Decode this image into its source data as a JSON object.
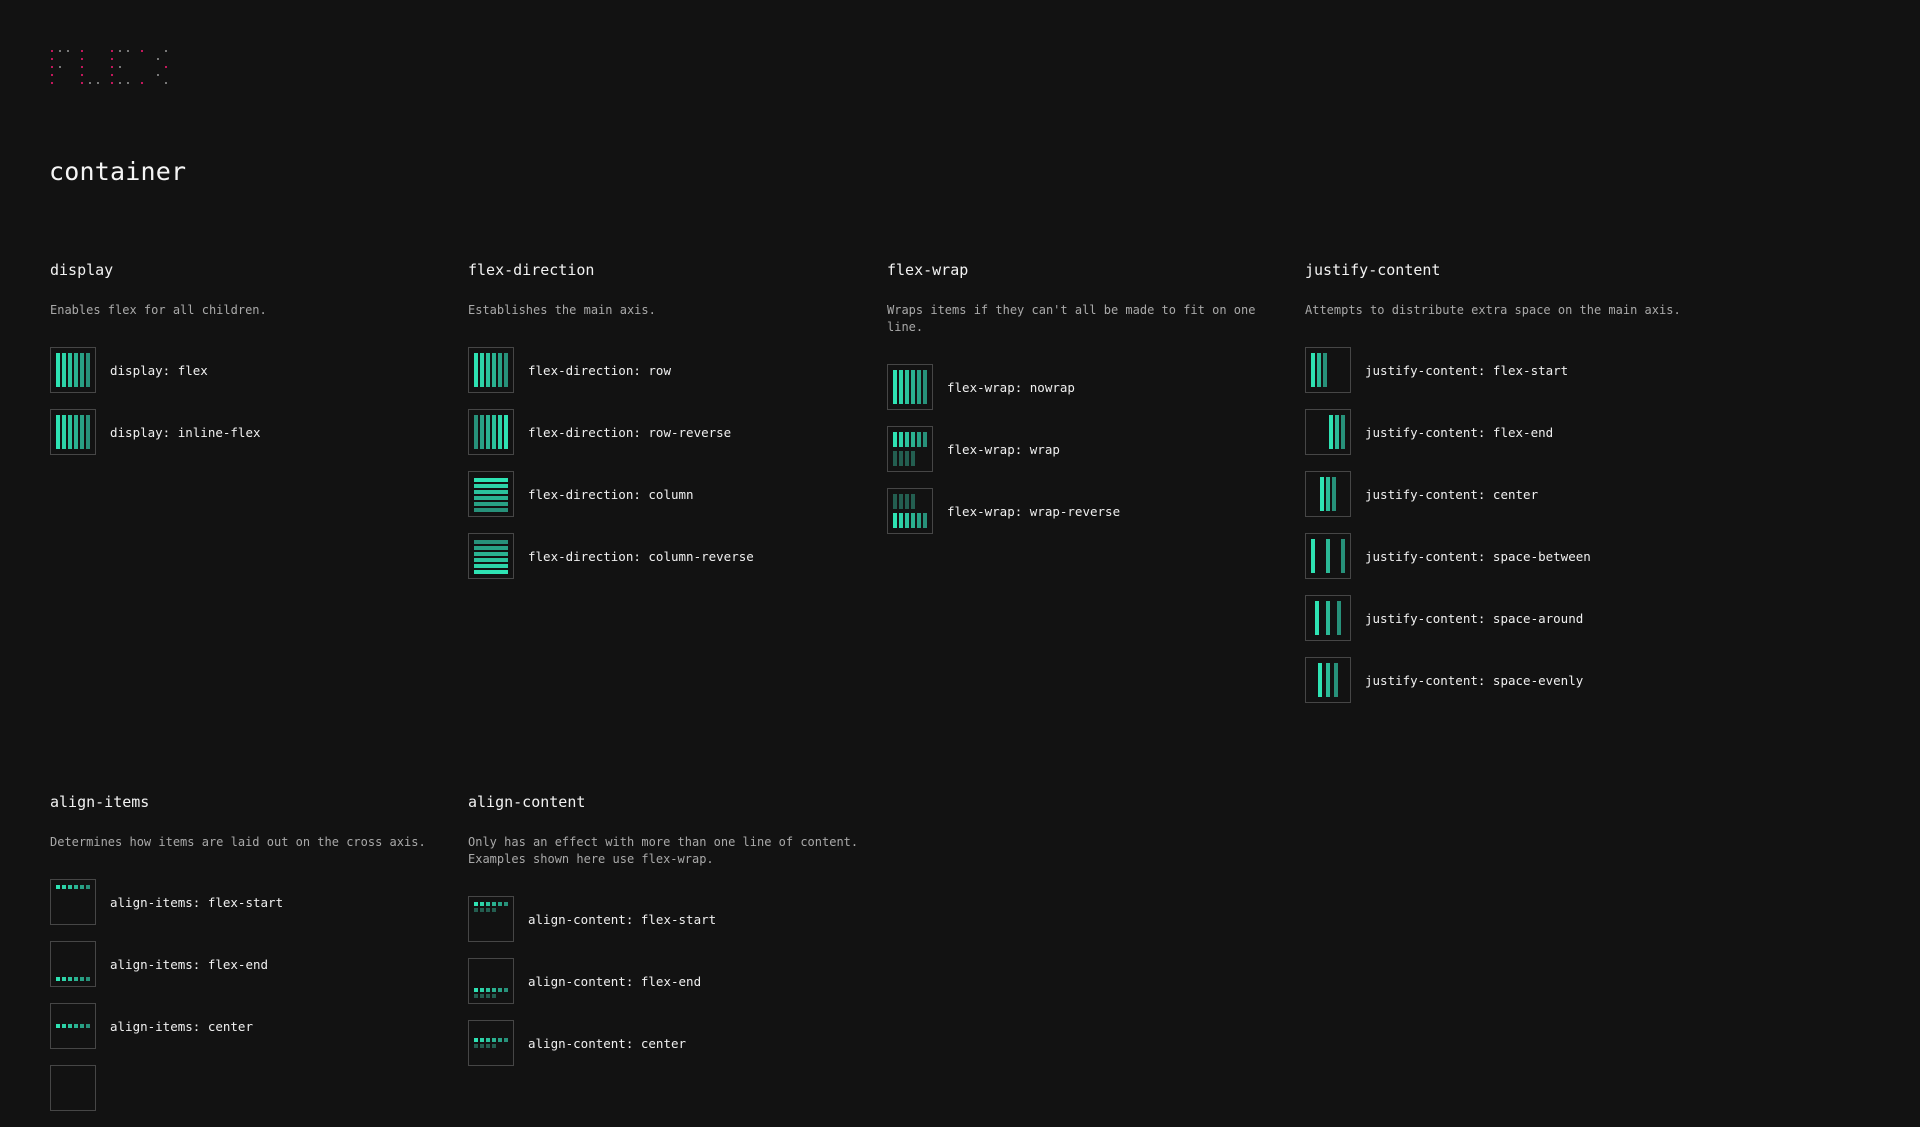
{
  "logo": {
    "text": "FLEX",
    "accent_color": "#c2185b",
    "dim_color": "#777777"
  },
  "colors": {
    "background": "#121212",
    "item_bright": "#2ee3b3",
    "item_dark": "#27917a",
    "item_muted": "#235e50",
    "box_border": "#464646"
  },
  "group_title": "container",
  "sections": {
    "display": {
      "title": "display",
      "desc": "Enables flex for all children.",
      "items": [
        "display: flex",
        "display: inline-flex"
      ]
    },
    "flex_direction": {
      "title": "flex-direction",
      "desc": "Establishes the main axis.",
      "items": [
        "flex-direction: row",
        "flex-direction: row-reverse",
        "flex-direction: column",
        "flex-direction: column-reverse"
      ]
    },
    "flex_wrap": {
      "title": "flex-wrap",
      "desc": "Wraps items if they can't all be made to fit on one line.",
      "items": [
        "flex-wrap: nowrap",
        "flex-wrap: wrap",
        "flex-wrap: wrap-reverse"
      ]
    },
    "justify_content": {
      "title": "justify-content",
      "desc": "Attempts to distribute extra space on the main axis.",
      "items": [
        "justify-content: flex-start",
        "justify-content: flex-end",
        "justify-content: center",
        "justify-content: space-between",
        "justify-content: space-around",
        "justify-content: space-evenly"
      ]
    },
    "align_items": {
      "title": "align-items",
      "desc": "Determines how items are laid out on the cross axis.",
      "items": [
        "align-items: flex-start",
        "align-items: flex-end",
        "align-items: center",
        ""
      ]
    },
    "align_content": {
      "title": "align-content",
      "desc": "Only has an effect with more than one line of content.\nExamples shown here use flex-wrap.",
      "items": [
        "align-content: flex-start",
        "align-content: flex-end",
        "align-content: center"
      ]
    }
  }
}
